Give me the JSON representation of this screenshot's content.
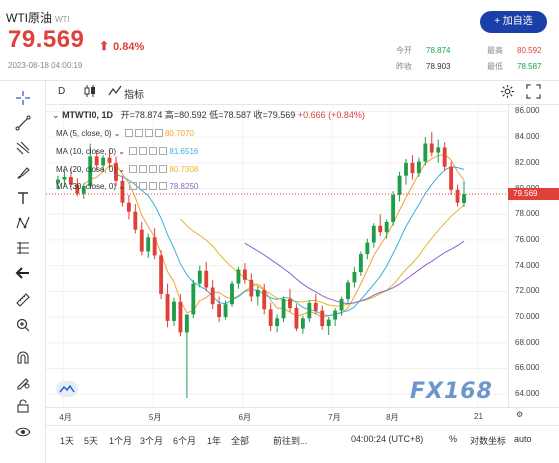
{
  "header": {
    "name": "WTI原油",
    "code": "WTI",
    "price": "79.569",
    "change_pct": "0.84%",
    "timestamp": "2023-08-18 04:00:19",
    "add_button": "+ 加自选",
    "stats": {
      "open_label": "今开",
      "open": "78.874",
      "high_label": "最高",
      "high": "80.592",
      "prev_label": "昨收",
      "prev": "78.903",
      "low_label": "最低",
      "low": "78.587"
    }
  },
  "toolbar": {
    "interval": "D",
    "indicators": "指标"
  },
  "legend": {
    "symbol": "MTWTI0, 1D",
    "open": "开=78.874",
    "high": "高=80.592",
    "low": "低=78.587",
    "close": "收=79.569",
    "change": "+0.666 (+0.84%)"
  },
  "ma_lines": [
    {
      "label": "MA (5, close, 0)",
      "value": "80.7070",
      "color": "#f2a230"
    },
    {
      "label": "MA (10, close, 0)",
      "value": "81.6516",
      "color": "#36b3d9"
    },
    {
      "label": "MA (20, close, 0)",
      "value": "80.7308",
      "color": "#e4b52a"
    },
    {
      "label": "MA (30, close, 0)",
      "value": "78.8250",
      "color": "#8a63c9"
    }
  ],
  "current_price_tag": "79.569",
  "watermark": "FX168",
  "bottom": {
    "r1": "1天",
    "r2": "5天",
    "r3": "1个月",
    "r4": "3个月",
    "r5": "6个月",
    "r6": "1年",
    "r7": "全部",
    "goto": "前往到...",
    "time": "04:00:24 (UTC+8)",
    "pct": "%",
    "log": "对数坐标",
    "auto": "auto"
  },
  "chart_data": {
    "type": "candlestick",
    "y_ticks": [
      "86.000",
      "84.000",
      "82.000",
      "80.000",
      "78.000",
      "76.000",
      "74.000",
      "72.000",
      "70.000",
      "68.000",
      "66.000",
      "64.000"
    ],
    "x_ticks": [
      "4月",
      "5月",
      "6月",
      "7月",
      "8月",
      "21"
    ],
    "ylim": [
      63,
      86.5
    ],
    "candles": [
      [
        80.4,
        81.0,
        79.9,
        80.7
      ],
      [
        80.7,
        81.4,
        80.2,
        80.9
      ],
      [
        80.9,
        81.6,
        80.1,
        80.3
      ],
      [
        80.3,
        80.8,
        79.4,
        79.6
      ],
      [
        79.6,
        80.4,
        79.2,
        80.2
      ],
      [
        80.2,
        83.5,
        80.0,
        82.5
      ],
      [
        82.5,
        83.0,
        81.4,
        81.8
      ],
      [
        81.8,
        82.6,
        81.3,
        82.4
      ],
      [
        82.4,
        83.1,
        81.6,
        82.0
      ],
      [
        82.0,
        82.5,
        80.2,
        80.6
      ],
      [
        80.6,
        81.0,
        78.6,
        78.9
      ],
      [
        78.9,
        79.5,
        77.6,
        78.2
      ],
      [
        78.2,
        78.8,
        76.5,
        76.8
      ],
      [
        76.8,
        77.4,
        74.8,
        75.1
      ],
      [
        75.1,
        76.5,
        74.6,
        76.2
      ],
      [
        76.2,
        76.9,
        74.5,
        74.8
      ],
      [
        74.8,
        75.2,
        71.4,
        71.8
      ],
      [
        71.8,
        72.6,
        69.2,
        69.7
      ],
      [
        69.7,
        71.5,
        69.3,
        71.2
      ],
      [
        71.2,
        71.8,
        68.5,
        68.8
      ],
      [
        68.8,
        69.5,
        63.7,
        70.2
      ],
      [
        70.2,
        72.9,
        69.9,
        72.6
      ],
      [
        72.6,
        74.0,
        72.3,
        73.6
      ],
      [
        73.6,
        74.3,
        72.0,
        72.3
      ],
      [
        72.3,
        72.9,
        70.6,
        71.0
      ],
      [
        71.0,
        71.6,
        69.6,
        70.0
      ],
      [
        70.0,
        71.3,
        69.8,
        71.0
      ],
      [
        71.0,
        72.8,
        70.8,
        72.6
      ],
      [
        72.6,
        73.9,
        72.2,
        73.7
      ],
      [
        73.7,
        74.2,
        72.6,
        72.9
      ],
      [
        72.9,
        73.4,
        71.2,
        71.6
      ],
      [
        71.6,
        72.4,
        70.9,
        72.1
      ],
      [
        72.1,
        72.6,
        70.2,
        70.6
      ],
      [
        70.6,
        71.1,
        68.9,
        69.3
      ],
      [
        69.3,
        70.2,
        68.8,
        69.9
      ],
      [
        69.9,
        71.6,
        69.6,
        71.4
      ],
      [
        71.4,
        72.2,
        70.4,
        70.7
      ],
      [
        70.7,
        71.0,
        68.9,
        69.1
      ],
      [
        69.1,
        70.1,
        68.7,
        69.9
      ],
      [
        69.9,
        71.3,
        69.6,
        71.1
      ],
      [
        71.1,
        71.8,
        70.2,
        70.5
      ],
      [
        70.5,
        70.9,
        69.0,
        69.3
      ],
      [
        69.3,
        70.0,
        68.6,
        69.8
      ],
      [
        69.8,
        70.7,
        69.3,
        70.5
      ],
      [
        70.5,
        71.6,
        70.1,
        71.4
      ],
      [
        71.4,
        72.9,
        71.1,
        72.7
      ],
      [
        72.7,
        73.9,
        72.3,
        73.5
      ],
      [
        73.5,
        75.1,
        73.2,
        74.9
      ],
      [
        74.9,
        76.1,
        74.5,
        75.8
      ],
      [
        75.8,
        77.3,
        75.4,
        77.1
      ],
      [
        77.1,
        78.0,
        76.3,
        76.6
      ],
      [
        76.6,
        77.6,
        76.1,
        77.4
      ],
      [
        77.4,
        79.8,
        77.1,
        79.5
      ],
      [
        79.5,
        81.3,
        79.0,
        81.0
      ],
      [
        81.0,
        82.3,
        80.3,
        82.0
      ],
      [
        82.0,
        82.6,
        80.7,
        81.2
      ],
      [
        81.2,
        82.4,
        80.9,
        82.1
      ],
      [
        82.1,
        84.0,
        81.8,
        83.5
      ],
      [
        83.5,
        84.4,
        82.5,
        82.8
      ],
      [
        82.8,
        83.8,
        82.0,
        83.2
      ],
      [
        83.2,
        83.6,
        81.4,
        81.7
      ],
      [
        81.7,
        82.1,
        79.5,
        79.9
      ],
      [
        79.9,
        80.3,
        78.6,
        78.9
      ],
      [
        78.874,
        80.592,
        78.587,
        79.569
      ]
    ],
    "ma5_color": "#f2a230",
    "ma10_color": "#36b3d9",
    "ma20_color": "#e4b52a",
    "ma30_color": "#8a63c9",
    "up_color": "#1f9e4a",
    "down_color": "#e0403a"
  }
}
